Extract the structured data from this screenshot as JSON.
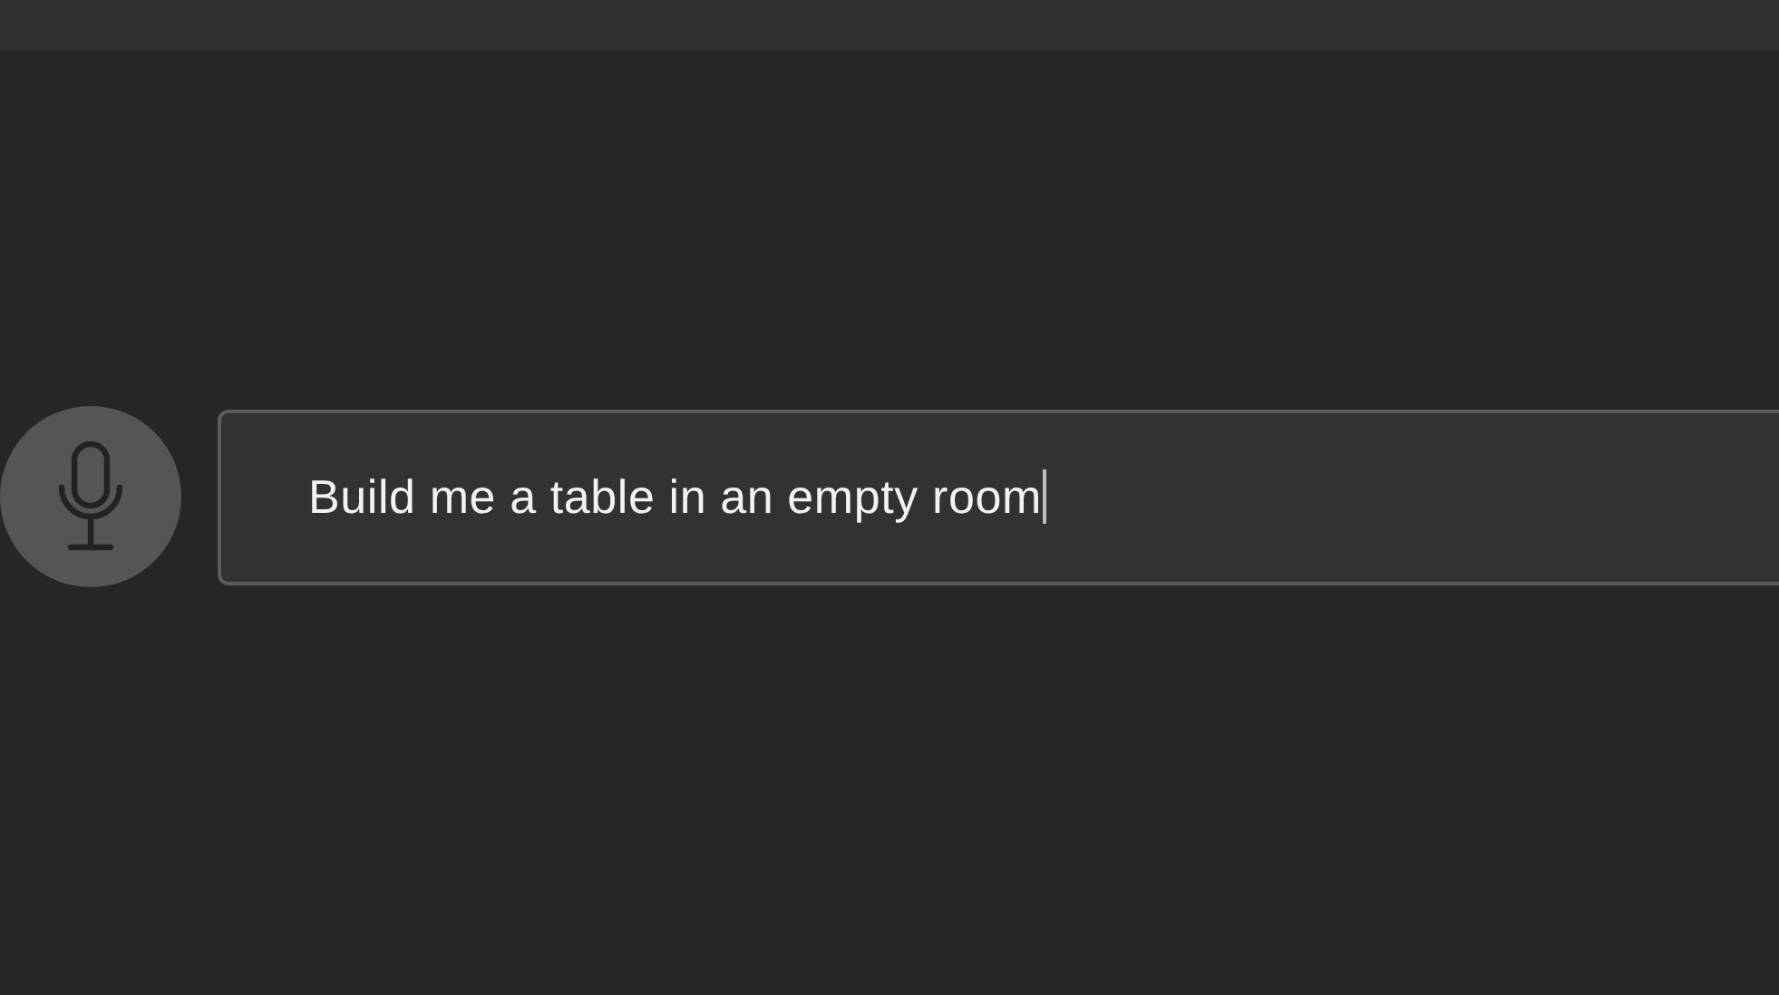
{
  "prompt": {
    "value": "Build me a table in an empty room",
    "focused": true
  }
}
